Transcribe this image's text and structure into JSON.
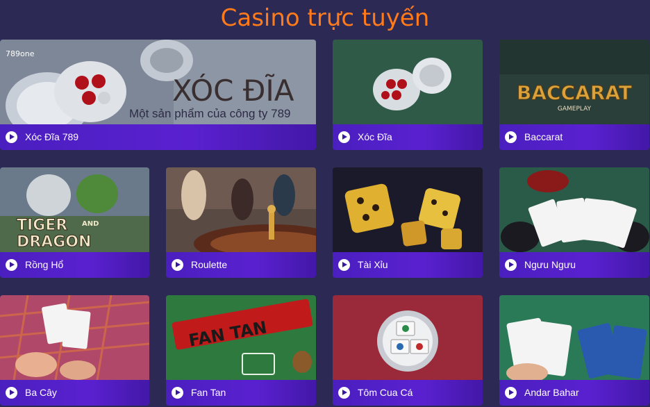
{
  "page": {
    "title": "Casino trực tuyến"
  },
  "games": [
    {
      "label": "Xóc Đĩa 789",
      "art": {
        "logo": "789one",
        "headline": "XÓC ĐĨA",
        "tagline": "Một sản phẩm của công ty 789"
      }
    },
    {
      "label": "Xóc Đĩa"
    },
    {
      "label": "Baccarat",
      "art": {
        "headline": "BACCARAT",
        "tagline": "GAMEPLAY"
      }
    },
    {
      "label": "Rồng Hổ",
      "art": {
        "headline": "TIGER",
        "sub": "AND",
        "headline2": "DRAGON"
      }
    },
    {
      "label": "Roulette"
    },
    {
      "label": "Tài Xỉu"
    },
    {
      "label": "Ngưu Ngưu"
    },
    {
      "label": "Ba Cây"
    },
    {
      "label": "Fan Tan",
      "art": {
        "headline": "FAN TAN"
      }
    },
    {
      "label": "Tôm Cua Cá"
    },
    {
      "label": "Andar Bahar"
    }
  ]
}
